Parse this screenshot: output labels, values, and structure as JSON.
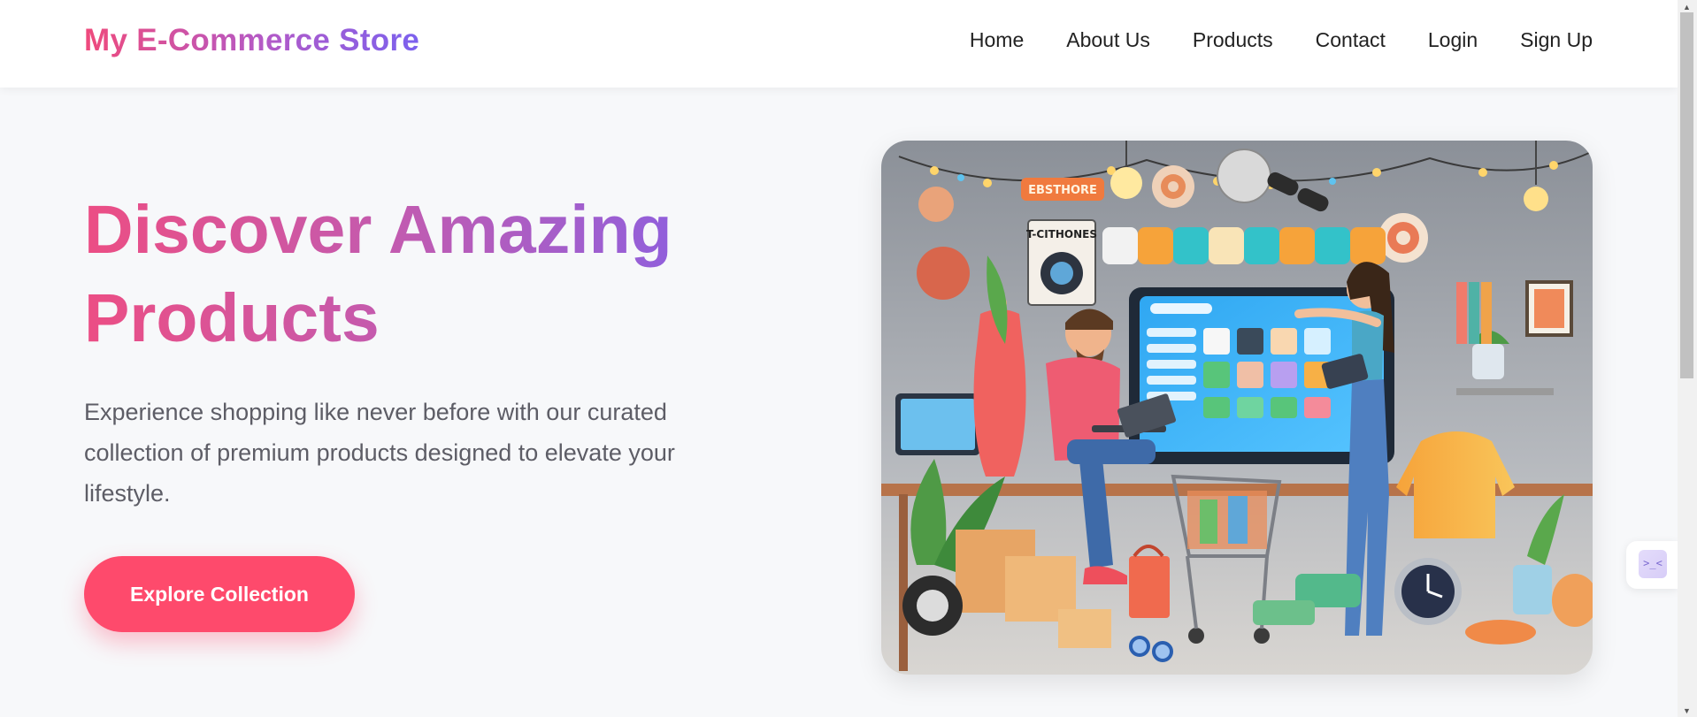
{
  "brand": {
    "name": "My E-Commerce Store"
  },
  "nav": {
    "items": [
      "Home",
      "About Us",
      "Products",
      "Contact",
      "Login",
      "Sign Up"
    ]
  },
  "hero": {
    "title": "Discover Amazing Products",
    "description": "Experience shopping like never before with our curated collection of premium products designed to elevate your lifestyle.",
    "cta_label": "Explore Collection",
    "image_alt": "Illustrated online store scene with shoppers, products and a shopping cart"
  },
  "widget": {
    "icon": "devtools-icon",
    "glyph": ">_<"
  },
  "colors": {
    "accent": "#fe4a6c",
    "gradient_start": "#ec4e84",
    "gradient_end": "#7f61eb",
    "text_muted": "#5d5d66"
  }
}
